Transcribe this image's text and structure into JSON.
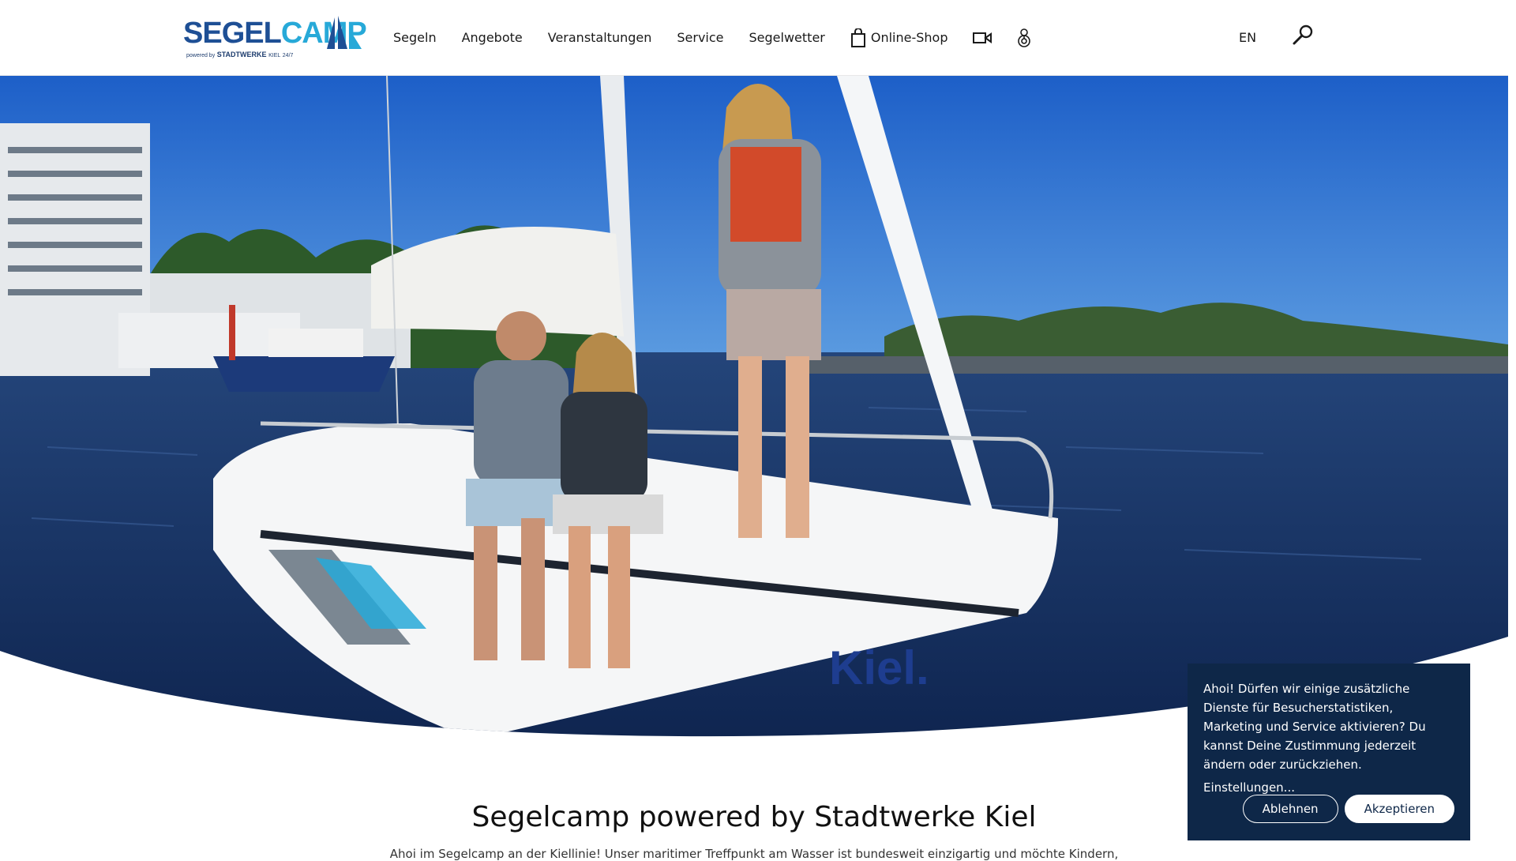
{
  "header": {
    "logo": {
      "word_a": "SEGEL",
      "word_b": "CAMP",
      "powered": "powered by",
      "brand": "STADTWERKE",
      "city": "KIEL",
      "tag": "24/7"
    },
    "nav": {
      "segeln": "Segeln",
      "angebote": "Angebote",
      "veranstaltungen": "Veranstaltungen",
      "service": "Service",
      "segelwetter": "Segelwetter",
      "shop": "Online-Shop"
    },
    "icons": {
      "shop": "shopping-bag-icon",
      "video": "video-camera-icon",
      "account": "life-buoy-person-icon",
      "search": "magnifier-icon"
    },
    "lang": "EN"
  },
  "hero": {
    "image": "sailing-boat-crew-photo",
    "boat_text": "Kiel."
  },
  "main": {
    "title": "Segelcamp powered by Stadtwerke Kiel",
    "intro": "Ahoi im Segelcamp an der Kiellinie! Unser maritimer Treffpunkt am Wasser ist bundesweit einzigartig und möchte Kindern,"
  },
  "cookie": {
    "text": "Ahoi! Dürfen wir einige zusätzliche Dienste für Besucherstatistiken, Marketing und Service aktivieren? Du kannst Deine Zustimmung jederzeit ändern oder zurückziehen.",
    "settings": "Einstellungen...",
    "decline": "Ablehnen",
    "accept": "Akzeptieren"
  },
  "colors": {
    "brand_dark": "#1e4f95",
    "brand_light": "#27a9d8",
    "banner": "#0e2748"
  }
}
